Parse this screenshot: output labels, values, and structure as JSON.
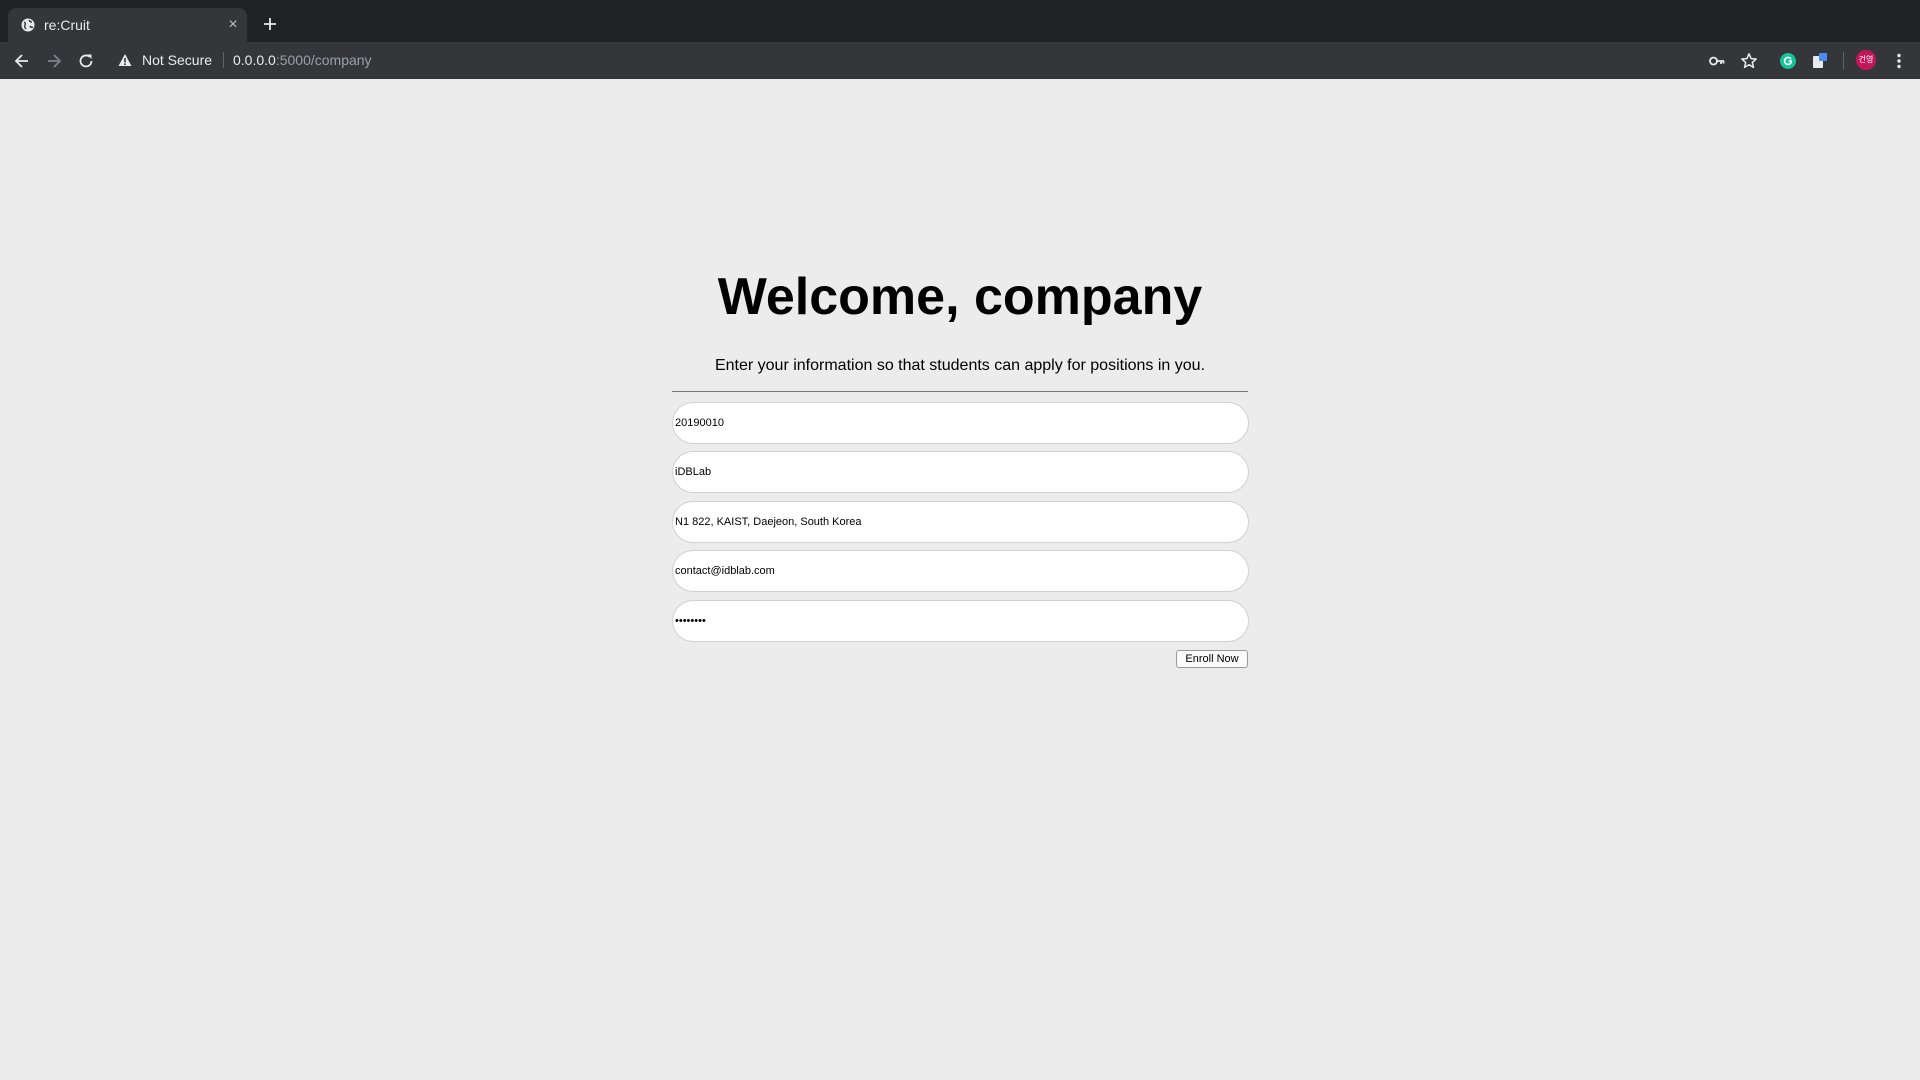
{
  "browser": {
    "tab_title": "re:Cruit",
    "tab_close": "×",
    "security_label": "Not Secure",
    "url_host": "0.0.0.0",
    "url_path": ":5000/company",
    "profile_initials": "건영"
  },
  "page": {
    "title": "Welcome, company",
    "subtitle": "Enter your information so that students can apply for positions in you.",
    "form": {
      "company_id": "20190010",
      "company_name": "iDBLab",
      "address": "N1 822, KAIST, Daejeon, South Korea",
      "email": "contact@idblab.com",
      "password": "password"
    },
    "enroll_label": "Enroll Now"
  }
}
